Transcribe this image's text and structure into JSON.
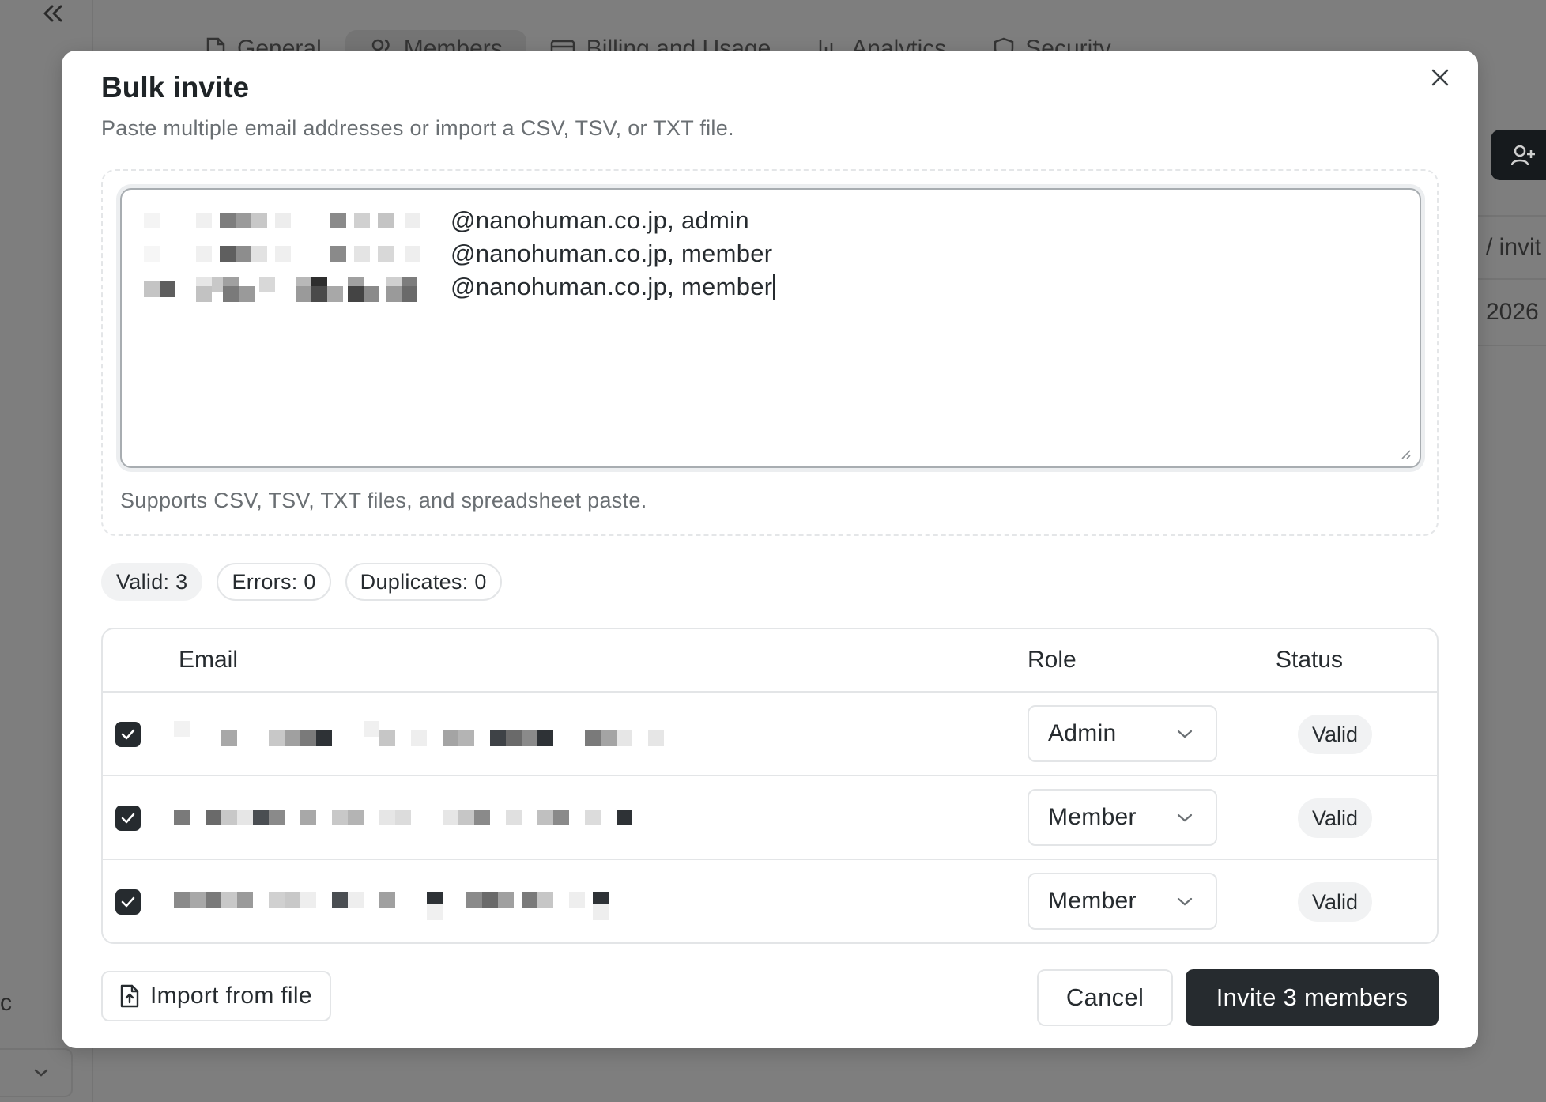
{
  "background": {
    "tabs": [
      {
        "label": "General",
        "icon": "document-icon"
      },
      {
        "label": "Members",
        "icon": "users-icon",
        "active": true
      },
      {
        "label": "Billing and Usage",
        "icon": "card-icon"
      },
      {
        "label": "Analytics",
        "icon": "chart-icon"
      },
      {
        "label": "Security",
        "icon": "shield-icon"
      }
    ],
    "sidebar_fragment": "c",
    "table_fragments": {
      "header": "/ invit",
      "cell": "2026"
    }
  },
  "modal": {
    "title": "Bulk invite",
    "subtitle": "Paste multiple email addresses or import a CSV, TSV, or TXT file.",
    "textarea_lines": [
      "@nanohuman.co.jp, admin",
      "@nanohuman.co.jp, member",
      "@nanohuman.co.jp, member"
    ],
    "dropzone_hint": "Supports CSV, TSV, TXT files, and spreadsheet paste.",
    "badges": {
      "valid": "Valid: 3",
      "errors": "Errors: 0",
      "duplicates": "Duplicates: 0"
    },
    "table": {
      "headers": {
        "email": "Email",
        "role": "Role",
        "status": "Status"
      },
      "rows": [
        {
          "checked": true,
          "role": "Admin",
          "status": "Valid"
        },
        {
          "checked": true,
          "role": "Member",
          "status": "Valid"
        },
        {
          "checked": true,
          "role": "Member",
          "status": "Valid"
        }
      ]
    },
    "buttons": {
      "import": "Import from file",
      "cancel": "Cancel",
      "invite": "Invite 3 members"
    }
  },
  "colors": {
    "overlay": "#7e7e7e",
    "primary": "#262b2f",
    "muted_text": "#6a6f73",
    "border": "#e3e5e7"
  }
}
